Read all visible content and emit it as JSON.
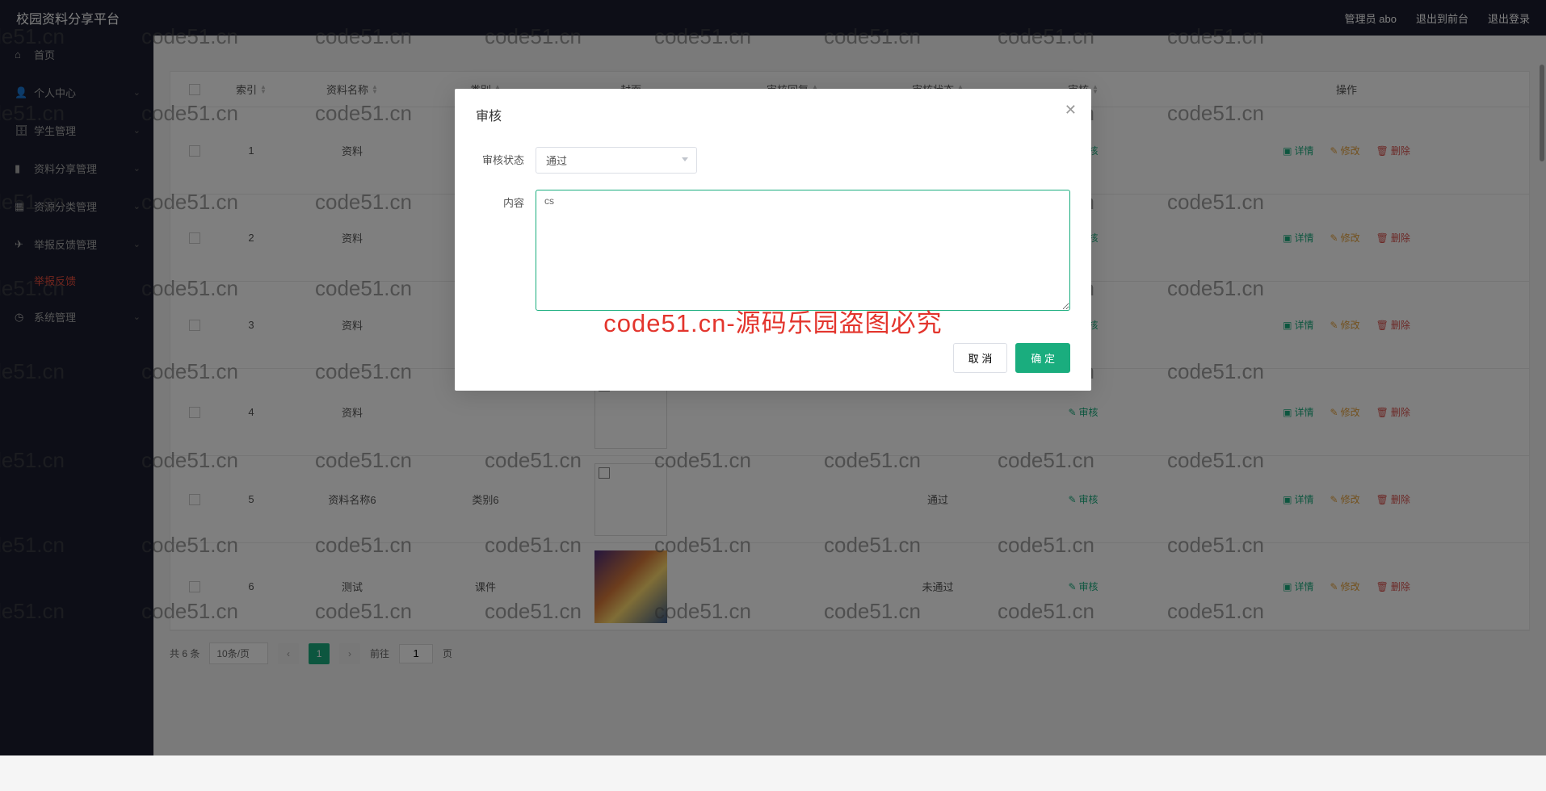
{
  "header": {
    "title": "校园资料分享平台",
    "admin_label": "管理员 abo",
    "back_front": "退出到前台",
    "logout": "退出登录"
  },
  "sidebar": {
    "items": [
      {
        "icon": "home",
        "label": "首页"
      },
      {
        "icon": "user",
        "label": "个人中心",
        "expand": true
      },
      {
        "icon": "folder",
        "label": "学生管理",
        "expand": true
      },
      {
        "icon": "bar",
        "label": "资料分享管理",
        "expand": true
      },
      {
        "icon": "grid",
        "label": "资源分类管理",
        "expand": true
      },
      {
        "icon": "plane",
        "label": "举报反馈管理",
        "expand": true
      },
      {
        "icon": "clock",
        "label": "系统管理",
        "expand": true
      }
    ],
    "active_sub": "举报反馈"
  },
  "table": {
    "headers": {
      "index": "索引",
      "name": "资料名称",
      "category": "类别",
      "cover": "封面",
      "reply": "审核回复",
      "status": "审核状态",
      "audit": "审核",
      "ops": "操作"
    },
    "rows": [
      {
        "idx": "1",
        "name": "资料",
        "cat": "",
        "status": "",
        "img": "broken"
      },
      {
        "idx": "2",
        "name": "资料",
        "cat": "",
        "status": "",
        "img": "broken"
      },
      {
        "idx": "3",
        "name": "资料",
        "cat": "",
        "status": "",
        "img": "broken"
      },
      {
        "idx": "4",
        "name": "资料",
        "cat": "",
        "status": "",
        "img": "broken"
      },
      {
        "idx": "5",
        "name": "资料名称6",
        "cat": "类别6",
        "status": "通过",
        "img": "broken"
      },
      {
        "idx": "6",
        "name": "测试",
        "cat": "课件",
        "status": "未通过",
        "img": "thumb"
      }
    ],
    "ops": {
      "audit": "审核",
      "detail": "详情",
      "edit": "修改",
      "delete": "删除"
    }
  },
  "pagination": {
    "total": "共 6 条",
    "page_size": "10条/页",
    "goto_prefix": "前往",
    "goto_suffix": "页",
    "current": "1"
  },
  "modal": {
    "title": "审核",
    "status_label": "审核状态",
    "status_value": "通过",
    "content_label": "内容",
    "content_value": "cs",
    "cancel": "取 消",
    "confirm": "确 定"
  },
  "watermark": {
    "gray": "code51.cn",
    "red": "code51.cn-源码乐园盗图必究"
  }
}
